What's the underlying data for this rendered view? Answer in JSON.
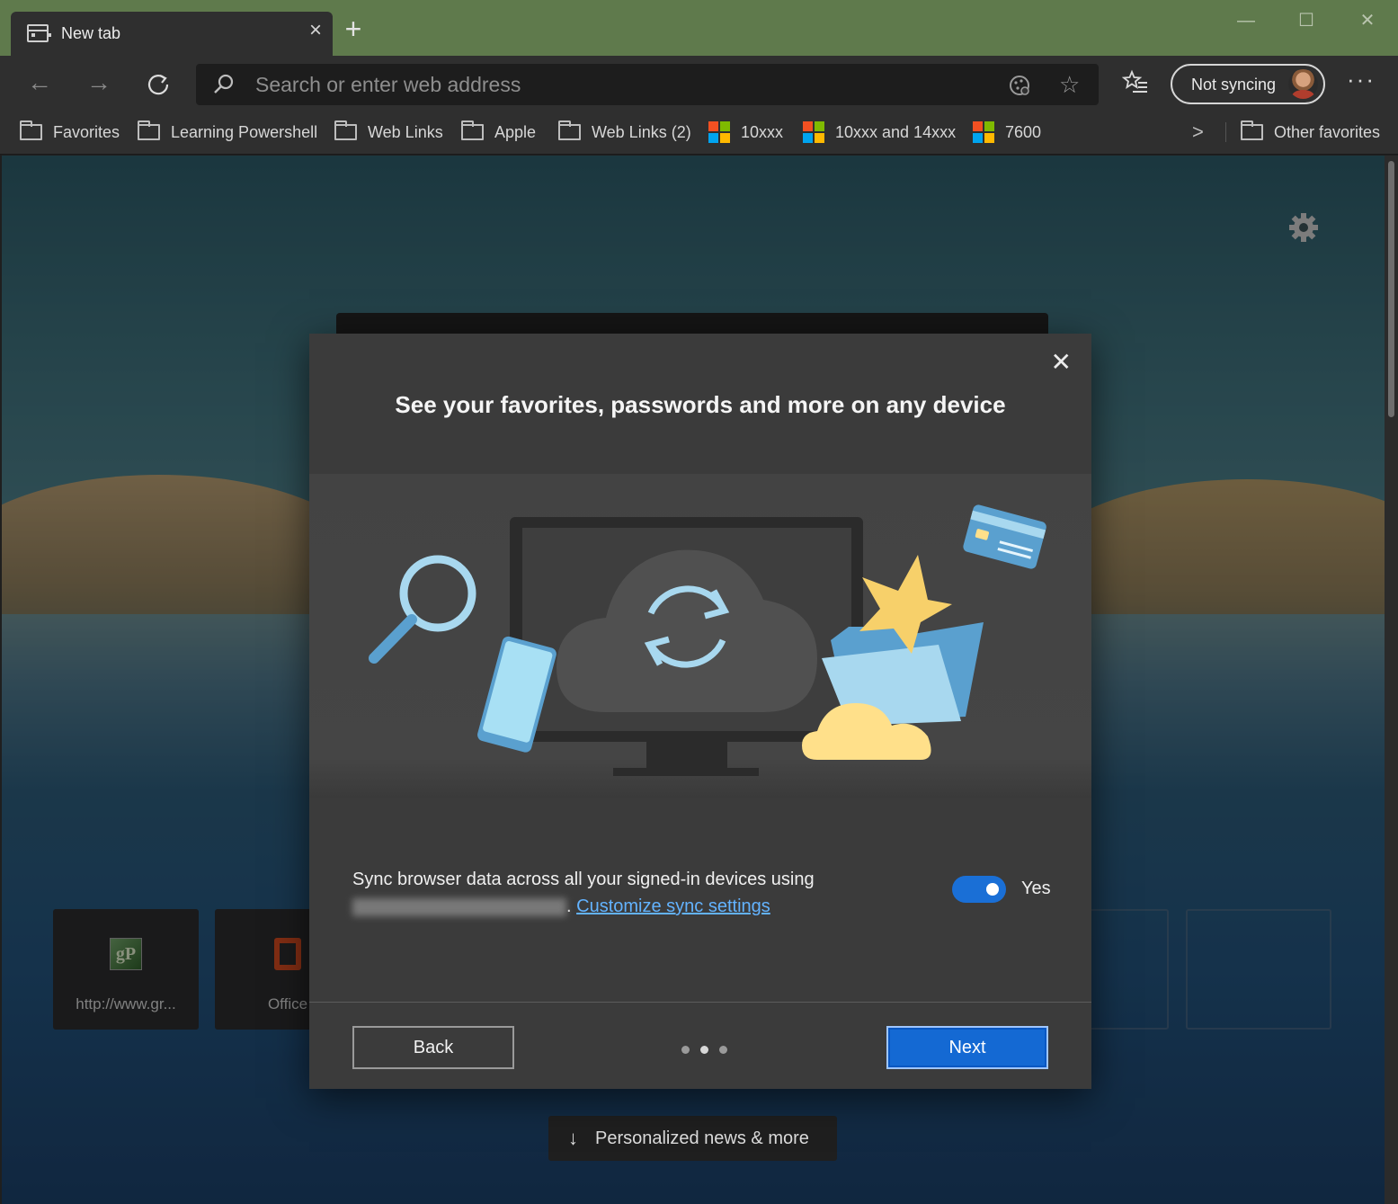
{
  "tab": {
    "title": "New tab"
  },
  "window": {
    "minimize": "—",
    "maximize": "☐",
    "close": "✕"
  },
  "toolbar": {
    "address_placeholder": "Search or enter web address",
    "profile_label": "Not syncing"
  },
  "favorites_bar": {
    "items": [
      {
        "label": "Favorites",
        "icon": "folder-icon"
      },
      {
        "label": "Learning Powershell",
        "icon": "folder-icon"
      },
      {
        "label": "Web Links",
        "icon": "folder-icon"
      },
      {
        "label": "Apple",
        "icon": "folder-icon"
      },
      {
        "label": "Web Links (2)",
        "icon": "folder-icon"
      },
      {
        "label": "10xxx",
        "icon": "windows-logo-icon"
      },
      {
        "label": "10xxx and 14xxx",
        "icon": "windows-logo-icon"
      },
      {
        "label": "7600",
        "icon": "windows-logo-icon"
      }
    ],
    "other_favorites": "Other favorites"
  },
  "new_tab_page": {
    "tiles": [
      {
        "label": "http://www.gr...",
        "icon": "gp-site-icon"
      },
      {
        "label": "Office",
        "icon": "office-icon"
      }
    ],
    "news_button": "Personalized news & more"
  },
  "dialog": {
    "title": "See your favorites, passwords and more on any device",
    "body_text": "Sync browser data across all your signed-in devices using",
    "link_text": "Customize sync settings",
    "toggle_label": "Yes",
    "toggle_on": true,
    "back_label": "Back",
    "next_label": "Next",
    "step_count": 3,
    "current_step": 2
  },
  "colors": {
    "accent": "#1469d3",
    "link": "#63b3ff",
    "titlebar": "#5f7a4c"
  }
}
